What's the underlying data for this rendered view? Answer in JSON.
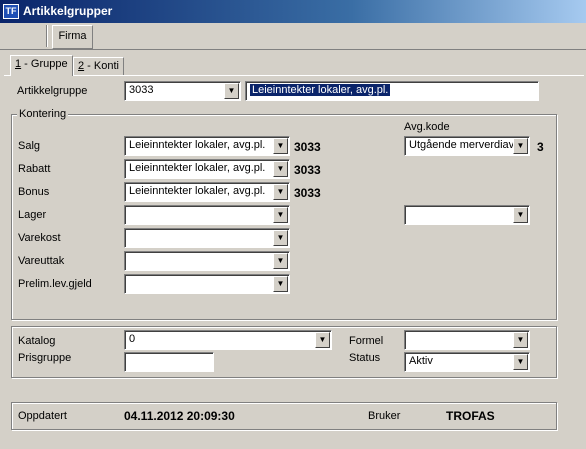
{
  "window": {
    "title": "Artikkelgrupper",
    "icon_text": "TF"
  },
  "toolbar": {
    "firma_label": "Firma"
  },
  "tabs": [
    {
      "key": "1",
      "rest": " - Gruppe"
    },
    {
      "key": "2",
      "rest": " - Konti"
    }
  ],
  "artikkelgruppe": {
    "label": "Artikkelgruppe",
    "code_value": "3033",
    "description": "Leieinntekter lokaler, avg.pl."
  },
  "kontering": {
    "legend": "Kontering",
    "avg_kode_label": "Avg.kode",
    "rows": [
      {
        "label": "Salg",
        "value": "Leieinntekter lokaler, avg.pl.",
        "code": "3033"
      },
      {
        "label": "Rabatt",
        "value": "Leieinntekter lokaler, avg.pl.",
        "code": "3033"
      },
      {
        "label": "Bonus",
        "value": "Leieinntekter lokaler, avg.pl.",
        "code": "3033"
      },
      {
        "label": "Lager",
        "value": "",
        "code": ""
      },
      {
        "label": "Varekost",
        "value": "",
        "code": ""
      },
      {
        "label": "Vareuttak",
        "value": "",
        "code": ""
      },
      {
        "label": "Prelim.lev.gjeld",
        "value": "",
        "code": ""
      }
    ],
    "avg_salg_value": "Utgående merverdiav",
    "avg_salg_code": "3",
    "avg_lager_value": ""
  },
  "lower": {
    "katalog_label": "Katalog",
    "katalog_value": "0",
    "prisgruppe_label": "Prisgruppe",
    "prisgruppe_value": "",
    "formel_label": "Formel",
    "formel_value": "",
    "status_label": "Status",
    "status_value": "Aktiv"
  },
  "footer": {
    "oppdatert_label": "Oppdatert",
    "oppdatert_value": "04.11.2012 20:09:30",
    "bruker_label": "Bruker",
    "bruker_value": "TROFAS"
  },
  "icons": {
    "dropdown": "chevron-down-icon"
  },
  "colors": {
    "titlebar": "#0a246a",
    "selection": "#0a246a",
    "window_bg": "#d4d0c8"
  }
}
